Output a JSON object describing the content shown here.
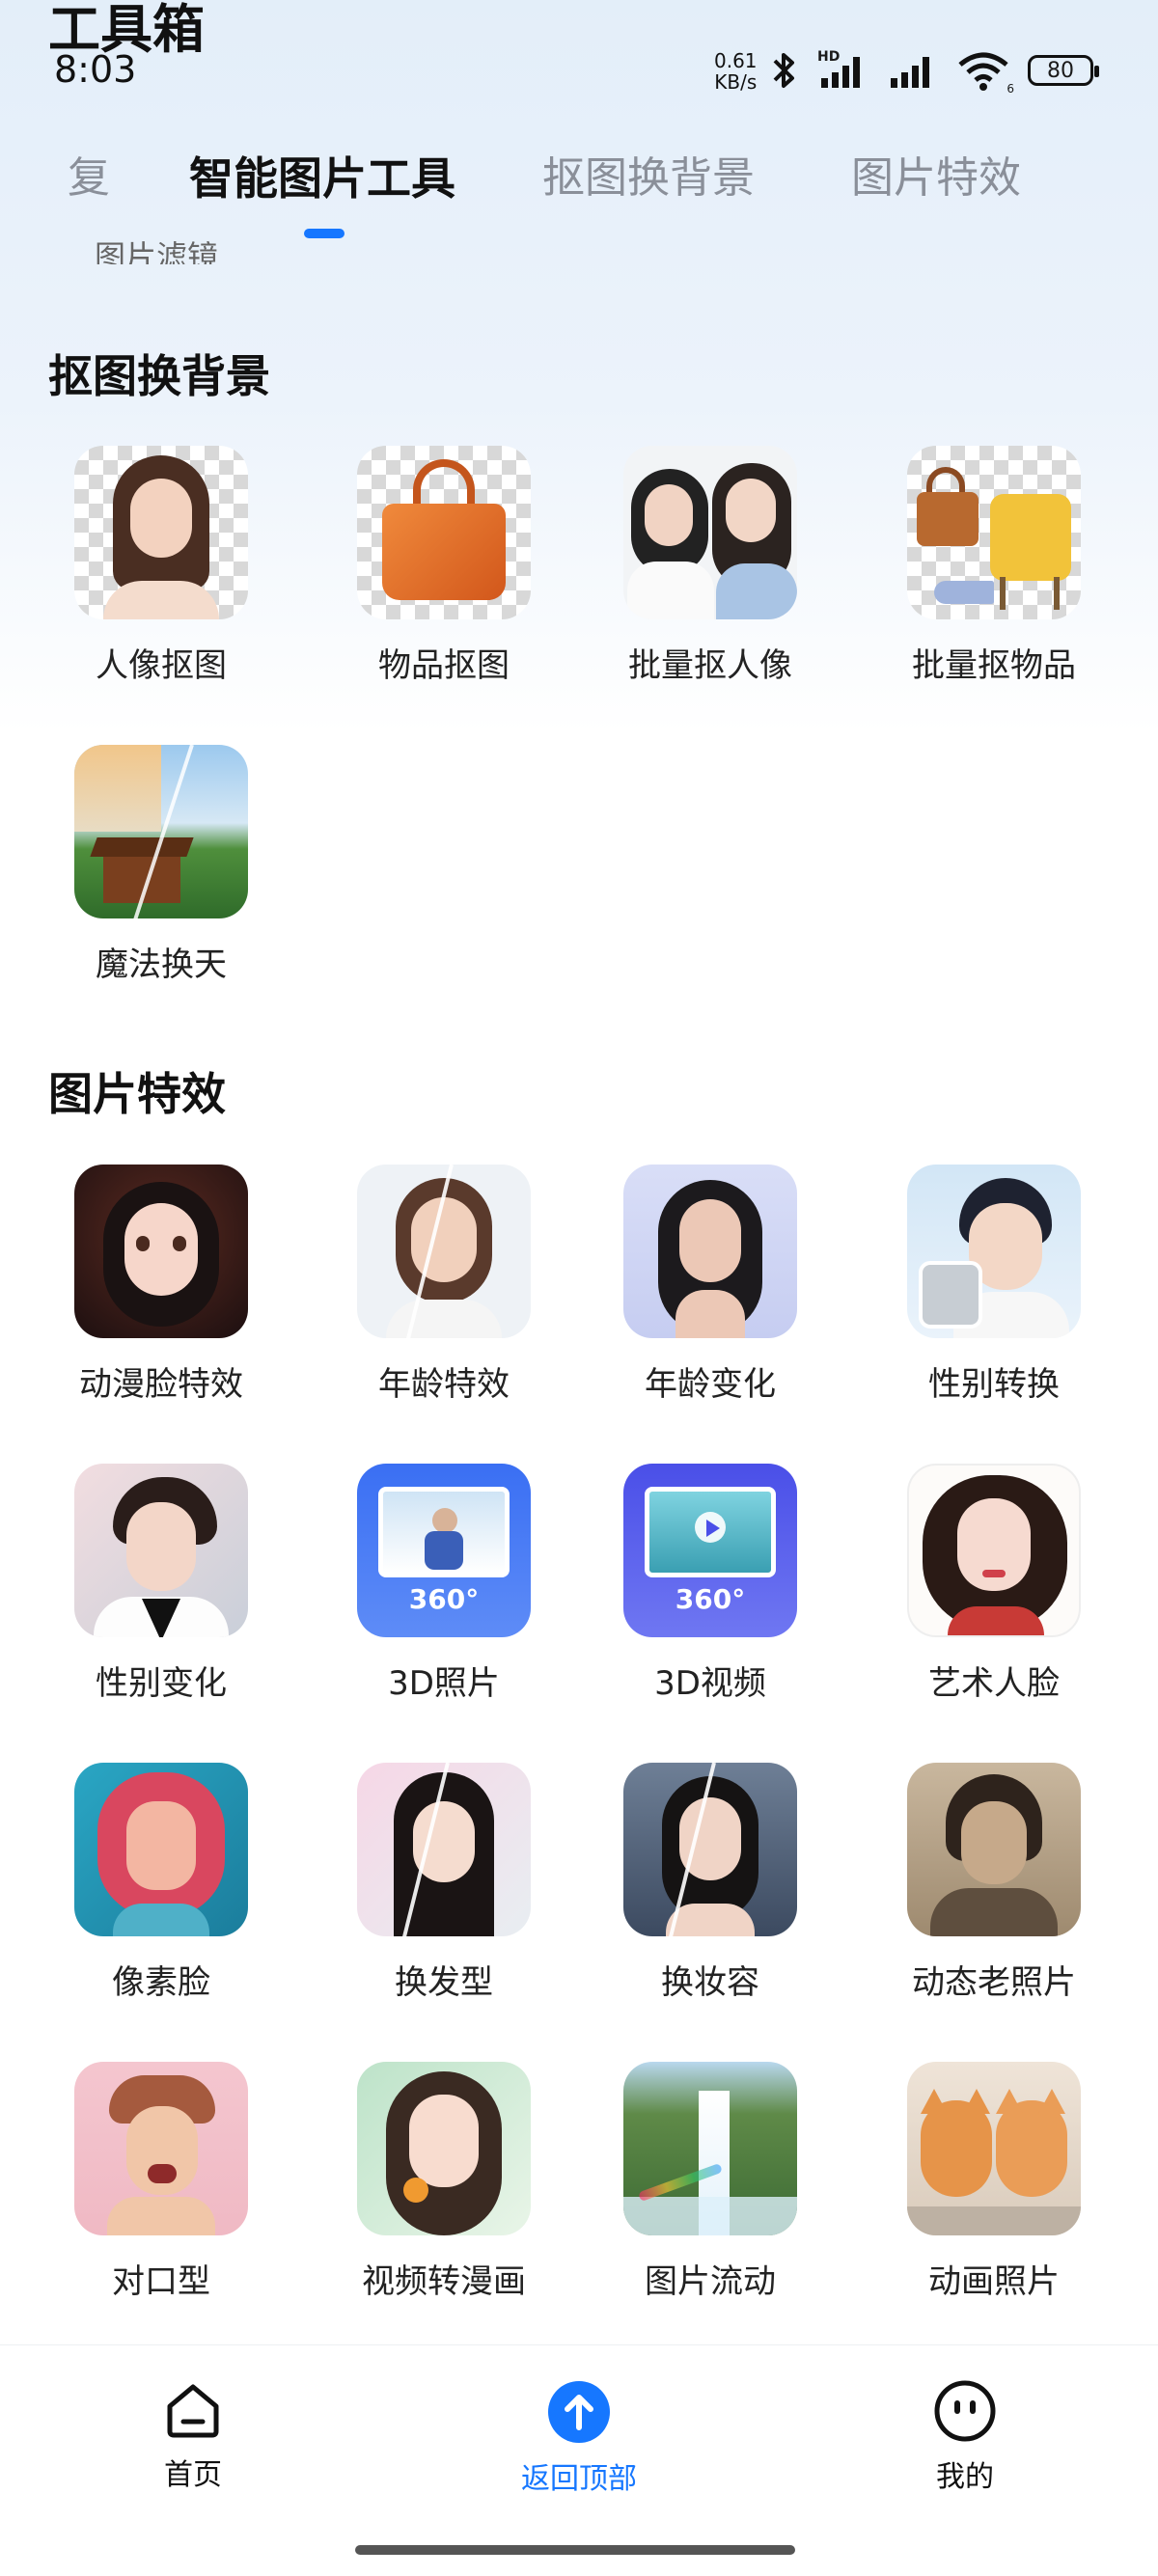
{
  "status_bar": {
    "app_title": "工具箱",
    "time": "8:03",
    "net_speed_value": "0.61",
    "net_speed_unit": "KB/s",
    "hd_label": "HD",
    "wifi_sub": "6",
    "battery": "80"
  },
  "tabs": [
    {
      "label": "复"
    },
    {
      "label": "智能图片工具"
    },
    {
      "label": "抠图换背景"
    },
    {
      "label": "图片特效"
    }
  ],
  "active_tab_index": 1,
  "partial_section_label": "图片滤镜",
  "sections": {
    "cutout": {
      "title": "抠图换背景",
      "items": [
        {
          "label": "人像抠图",
          "icon": "portrait-cutout-icon"
        },
        {
          "label": "物品抠图",
          "icon": "handbag-cutout-icon"
        },
        {
          "label": "批量抠人像",
          "icon": "batch-portrait-icon"
        },
        {
          "label": "批量抠物品",
          "icon": "batch-items-icon"
        },
        {
          "label": "魔法换天",
          "icon": "sky-replace-icon"
        }
      ]
    },
    "effects": {
      "title": "图片特效",
      "items": [
        {
          "label": "动漫脸特效",
          "icon": "anime-face-icon"
        },
        {
          "label": "年龄特效",
          "icon": "age-effect-icon"
        },
        {
          "label": "年龄变化",
          "icon": "age-change-icon"
        },
        {
          "label": "性别转换",
          "icon": "gender-swap-icon"
        },
        {
          "label": "性别变化",
          "icon": "gender-change-icon"
        },
        {
          "label": "3D照片",
          "icon": "photo-3d-icon"
        },
        {
          "label": "3D视频",
          "icon": "video-3d-icon"
        },
        {
          "label": "艺术人脸",
          "icon": "art-face-icon"
        },
        {
          "label": "像素脸",
          "icon": "pixel-face-icon"
        },
        {
          "label": "换发型",
          "icon": "hairstyle-icon"
        },
        {
          "label": "换妆容",
          "icon": "makeup-icon"
        },
        {
          "label": "动态老照片",
          "icon": "old-photo-icon"
        },
        {
          "label": "对口型",
          "icon": "lip-sync-icon"
        },
        {
          "label": "视频转漫画",
          "icon": "video-comic-icon"
        },
        {
          "label": "图片流动",
          "icon": "image-flow-icon"
        },
        {
          "label": "动画照片",
          "icon": "animated-photo-icon"
        }
      ]
    }
  },
  "badge_360": "360°",
  "bottom_nav": [
    {
      "label": "首页",
      "icon": "home-icon"
    },
    {
      "label": "返回顶部",
      "icon": "back-to-top-icon"
    },
    {
      "label": "我的",
      "icon": "profile-face-icon"
    }
  ],
  "colors": {
    "accent": "#1677ff",
    "tab_inactive": "#8a8f99",
    "text_primary": "#111111"
  }
}
